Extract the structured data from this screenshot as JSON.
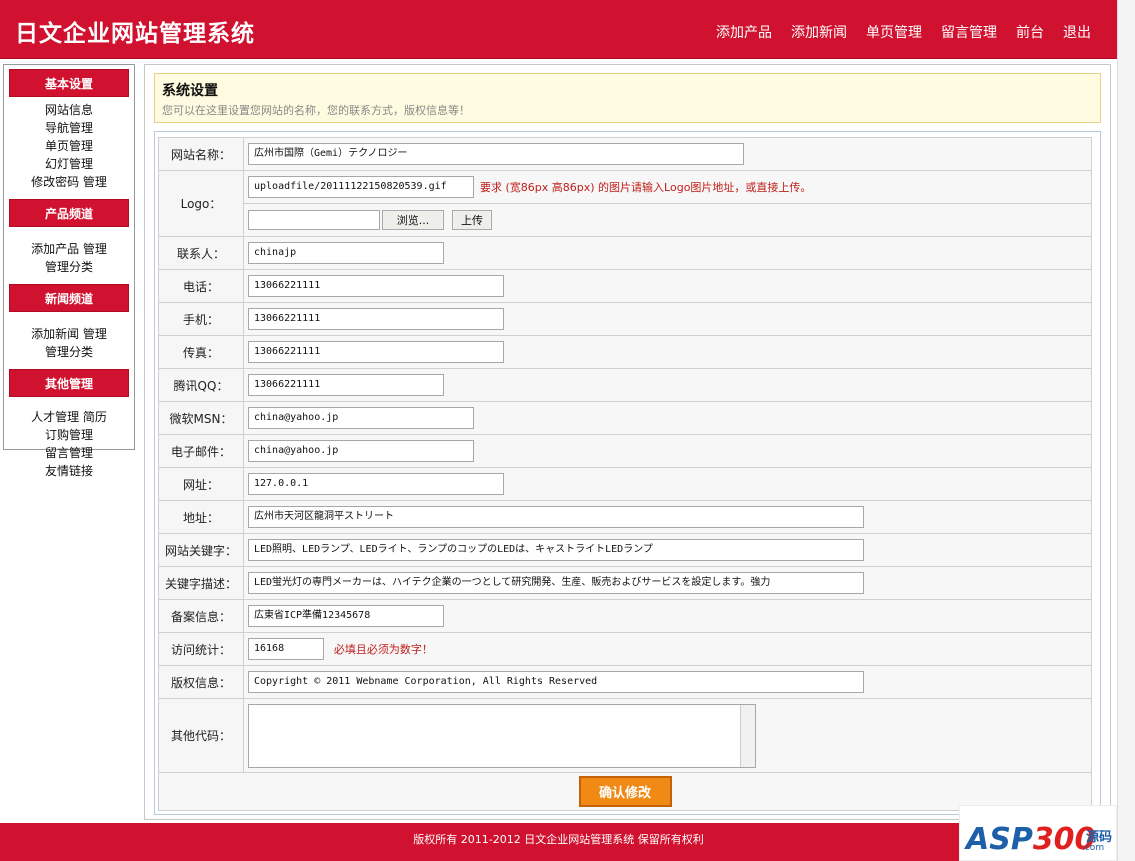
{
  "header": {
    "title": "日文企业网站管理系统",
    "nav": [
      "添加产品",
      "添加新闻",
      "单页管理",
      "留言管理",
      "前台",
      "退出"
    ]
  },
  "sidebar": {
    "groups": [
      {
        "title": "基本设置",
        "links": [
          [
            "网站信息"
          ],
          [
            "导航管理"
          ],
          [
            "单页管理"
          ],
          [
            "幻灯管理"
          ],
          [
            "修改密码",
            "管理"
          ]
        ]
      },
      {
        "title": "产品频道",
        "links": [
          [
            "添加产品",
            "管理"
          ],
          [
            "管理分类"
          ]
        ]
      },
      {
        "title": "新闻频道",
        "links": [
          [
            "添加新闻",
            "管理"
          ],
          [
            "管理分类"
          ]
        ]
      },
      {
        "title": "其他管理",
        "links": [
          [
            "人才管理",
            "简历"
          ],
          [
            "订购管理"
          ],
          [
            "留言管理"
          ],
          [
            "友情链接"
          ]
        ]
      }
    ]
  },
  "notice": {
    "title": "系统设置",
    "desc": "您可以在这里设置您网站的名称，您的联系方式，版权信息等！"
  },
  "form": {
    "site_name": {
      "label": "网站名称：",
      "value": "広州市国際（Gemi）テクノロジー"
    },
    "logo": {
      "label": "Logo：",
      "value": "uploadfile/20111122150820539.gif",
      "hint": "要求 (宽86px 高86px) 的图片请输入Logo图片地址，或直接上传。",
      "file_value": "",
      "browse": "浏览...",
      "upload": "上传"
    },
    "contact": {
      "label": "联系人：",
      "value": "chinajp"
    },
    "phone": {
      "label": "电话：",
      "value": "13066221111"
    },
    "mobile": {
      "label": "手机：",
      "value": "13066221111"
    },
    "fax": {
      "label": "传真：",
      "value": "13066221111"
    },
    "qq": {
      "label": "腾讯QQ：",
      "value": "13066221111"
    },
    "msn": {
      "label": "微软MSN：",
      "value": "china@yahoo.jp"
    },
    "email": {
      "label": "电子邮件：",
      "value": "china@yahoo.jp"
    },
    "url": {
      "label": "网址：",
      "value": "127.0.0.1"
    },
    "address": {
      "label": "地址：",
      "value": "広州市天河区龍洞平ストリート"
    },
    "keywords": {
      "label": "网站关键字：",
      "value": "LED照明、LEDランプ、LEDライト、ランプのコップのLEDは、キャストライトLEDランプ"
    },
    "description": {
      "label": "关键字描述：",
      "value": "LED蛍光灯の専門メーカーは、ハイテク企業の一つとして研究開発、生産、販売およびサービスを設定します。強力"
    },
    "icp": {
      "label": "备案信息：",
      "value": "広東省ICP準備12345678"
    },
    "stats": {
      "label": "访问统计：",
      "value": "16168",
      "hint": "必填且必须为数字！"
    },
    "copyright": {
      "label": "版权信息：",
      "value": "Copyright © 2011 Webname Corporation, All Rights Reserved"
    },
    "other_code": {
      "label": "其他代码：",
      "value": ""
    },
    "submit": "确认修改"
  },
  "footer": {
    "text": "版权所有 2011-2012 日文企业网站管理系统 保留所有权利"
  },
  "watermark": {
    "text_a": "ASP",
    "text_b": "300",
    "cn": "源码",
    "com": ".com"
  },
  "colors": {
    "brand": "#d0112f",
    "submit": "#f08a14",
    "hint": "#c0201c"
  }
}
